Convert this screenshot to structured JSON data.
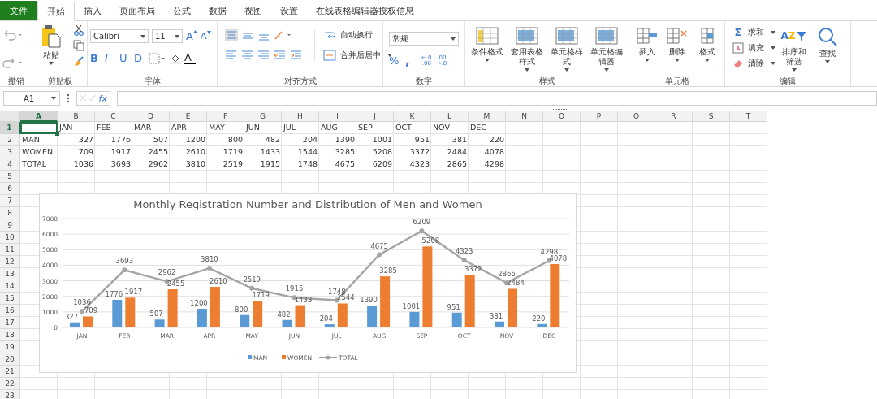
{
  "file_tab": "文件",
  "tabs": [
    {
      "label": "开始",
      "selected": true
    },
    {
      "label": "插入",
      "selected": false
    },
    {
      "label": "页面布局",
      "selected": false
    },
    {
      "label": "公式",
      "selected": false
    },
    {
      "label": "数据",
      "selected": false
    },
    {
      "label": "视图",
      "selected": false
    },
    {
      "label": "设置",
      "selected": false
    },
    {
      "label": "在线表格编辑器授权信息",
      "selected": false
    }
  ],
  "ribbon": {
    "undo": {
      "title": "撤销"
    },
    "clipboard": {
      "title": "剪贴板",
      "paste": "粘贴"
    },
    "font": {
      "title": "字体",
      "family": "Calibri",
      "size": "11",
      "grow": "A",
      "shrink": "A",
      "styles": [
        "B",
        "I",
        "U",
        "D"
      ],
      "color_letter": "A"
    },
    "alignment": {
      "title": "对齐方式",
      "wrap": "自动换行",
      "merge": "合并后居中"
    },
    "number": {
      "title": "数字",
      "format": "常规",
      "percent": "%",
      "comma": ",",
      "decimals": [
        [
          "←.0",
          ".00"
        ],
        [
          ".00",
          "→.0"
        ]
      ]
    },
    "styles": {
      "title": "样式",
      "buttons": [
        "条件格式",
        "套用表格样式",
        "单元格样式",
        "单元格编辑器"
      ]
    },
    "cells": {
      "title": "单元格",
      "buttons": [
        "插入",
        "删除",
        "格式"
      ]
    },
    "editing": {
      "title": "编辑",
      "sum_symbol": "Σ",
      "small": [
        "求和",
        "填充",
        "清除"
      ],
      "sort_letters": [
        "A",
        "Z"
      ],
      "buttons": [
        "排序和筛选",
        "查找"
      ]
    }
  },
  "formula_bar": {
    "name_box": "A1",
    "fx": "fx"
  },
  "sheet": {
    "columns": [
      {
        "label": "A",
        "selected": true
      },
      {
        "label": "B",
        "selected": false
      },
      {
        "label": "C",
        "selected": false
      },
      {
        "label": "D",
        "selected": false
      },
      {
        "label": "E",
        "selected": false
      },
      {
        "label": "F",
        "selected": false
      },
      {
        "label": "G",
        "selected": false
      },
      {
        "label": "H",
        "selected": false
      },
      {
        "label": "I",
        "selected": false
      },
      {
        "label": "J",
        "selected": false
      },
      {
        "label": "K",
        "selected": false
      },
      {
        "label": "L",
        "selected": false
      },
      {
        "label": "M",
        "selected": false
      },
      {
        "label": "N",
        "selected": false
      },
      {
        "label": "O",
        "selected": false
      },
      {
        "label": "P",
        "selected": false
      },
      {
        "label": "Q",
        "selected": false
      },
      {
        "label": "R",
        "selected": false
      },
      {
        "label": "S",
        "selected": false
      },
      {
        "label": "T",
        "selected": false
      }
    ],
    "rows": [
      {
        "number": "1",
        "selected": true,
        "kind": "header",
        "values": [
          "JAN",
          "FEB",
          "MAR",
          "APR",
          "MAY",
          "JUN",
          "JUL",
          "AUG",
          "SEP",
          "OCT",
          "NOV",
          "DEC"
        ]
      },
      {
        "number": "2",
        "selected": false,
        "kind": "data",
        "label": "MAN",
        "values": [
          "327",
          "1776",
          "507",
          "1200",
          "800",
          "482",
          "204",
          "1390",
          "1001",
          "951",
          "381",
          "220"
        ]
      },
      {
        "number": "3",
        "selected": false,
        "kind": "data",
        "label": "WOMEN",
        "values": [
          "709",
          "1917",
          "2455",
          "2610",
          "1719",
          "1433",
          "1544",
          "3285",
          "5208",
          "3372",
          "2484",
          "4078"
        ]
      },
      {
        "number": "4",
        "selected": false,
        "kind": "data",
        "label": "TOTAL",
        "values": [
          "1036",
          "3693",
          "2962",
          "3810",
          "2519",
          "1915",
          "1748",
          "4675",
          "6209",
          "4323",
          "2865",
          "4298"
        ]
      },
      {
        "number": "5",
        "selected": false
      },
      {
        "number": "6",
        "selected": false
      },
      {
        "number": "7",
        "selected": false
      },
      {
        "number": "8",
        "selected": false
      },
      {
        "number": "9",
        "selected": false
      },
      {
        "number": "10",
        "selected": false
      },
      {
        "number": "11",
        "selected": false
      },
      {
        "number": "12",
        "selected": false
      },
      {
        "number": "13",
        "selected": false
      },
      {
        "number": "14",
        "selected": false
      },
      {
        "number": "15",
        "selected": false
      },
      {
        "number": "16",
        "selected": false
      },
      {
        "number": "17",
        "selected": false
      },
      {
        "number": "18",
        "selected": false
      },
      {
        "number": "19",
        "selected": false
      },
      {
        "number": "20",
        "selected": false
      },
      {
        "number": "21",
        "selected": false
      },
      {
        "number": "22",
        "selected": false
      },
      {
        "number": "23",
        "selected": false
      }
    ],
    "chart": {
      "chart_data": {
        "type": "bar",
        "title": "Monthly Registration Number and Distribution of Men and Women",
        "categories": [
          "JAN",
          "FEB",
          "MAR",
          "APR",
          "MAY",
          "JUN",
          "JUL",
          "AUG",
          "SEP",
          "OCT",
          "NOV",
          "DEC"
        ],
        "series": [
          {
            "name": "MAN",
            "color": "#5b9bd5",
            "type": "bar",
            "values": [
              327,
              1776,
              507,
              1200,
              800,
              482,
              204,
              1390,
              1001,
              951,
              381,
              220
            ]
          },
          {
            "name": "WOMEN",
            "color": "#ed7d31",
            "type": "bar",
            "values": [
              709,
              1917,
              2455,
              2610,
              1719,
              1433,
              1544,
              3285,
              5208,
              3372,
              2484,
              4078
            ]
          },
          {
            "name": "TOTAL",
            "color": "#a5a5a5",
            "type": "line",
            "marker": true,
            "values": [
              1036,
              3693,
              2962,
              3810,
              2519,
              1915,
              1748,
              4675,
              6209,
              4323,
              2865,
              4298
            ]
          }
        ],
        "ylim": [
          0,
          7000
        ],
        "yticks": [
          0,
          1000,
          2000,
          3000,
          4000,
          5000,
          6000,
          7000
        ],
        "data_labels": true,
        "grid": true,
        "legend": "bottom"
      }
    }
  }
}
